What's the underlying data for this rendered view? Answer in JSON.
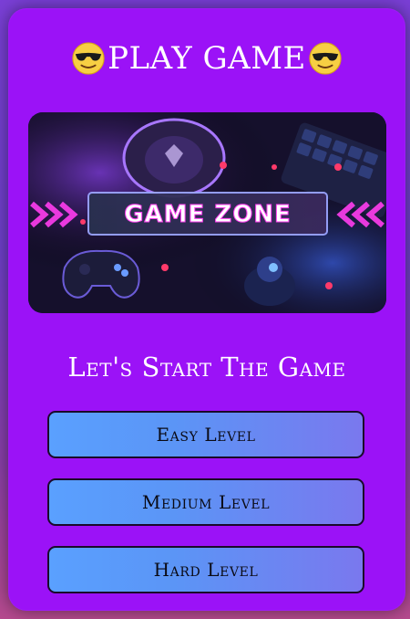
{
  "header": {
    "title": "PLAY GAME",
    "left_icon": "cool-sunglasses-emoji",
    "right_icon": "cool-sunglasses-emoji"
  },
  "banner": {
    "text": "GAME ZONE",
    "image_description_icon": "gaming-setup-image"
  },
  "subtitle": "Let's Start The Game",
  "buttons": {
    "easy": "Easy Level",
    "medium": "Medium Level",
    "hard": "Hard Level"
  },
  "colors": {
    "card_background": "#9b12f7",
    "button_gradient_start": "#5aa0ff",
    "button_gradient_end": "#7a78ee",
    "neon_accent": "#ff3df0"
  }
}
